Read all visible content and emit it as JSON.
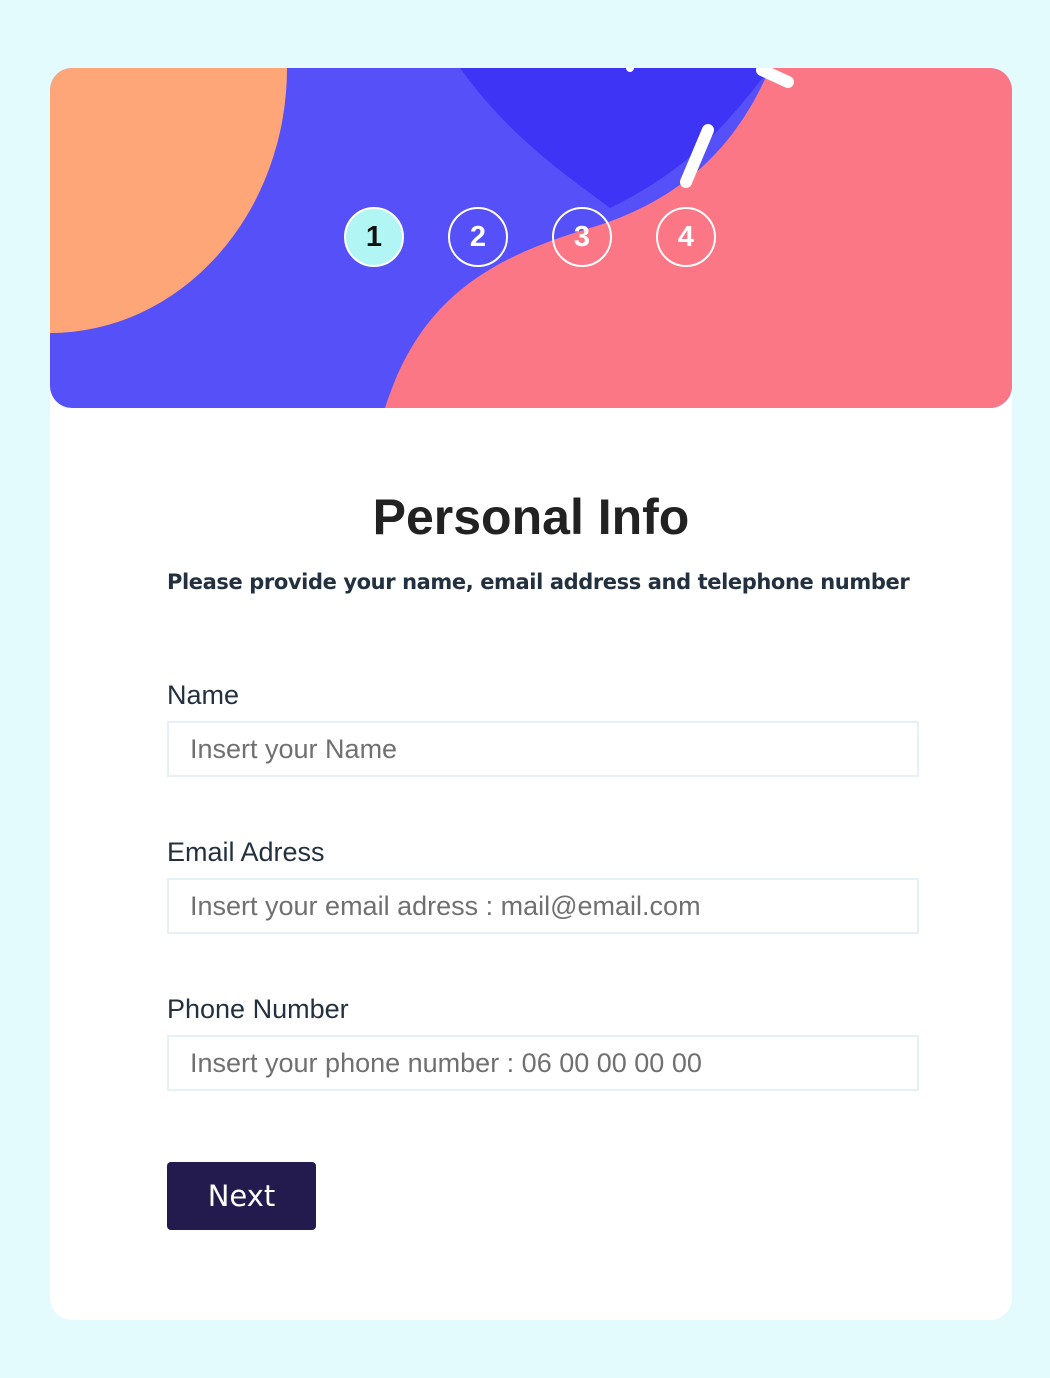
{
  "steps": [
    {
      "number": "1",
      "active": true
    },
    {
      "number": "2",
      "active": false
    },
    {
      "number": "3",
      "active": false
    },
    {
      "number": "4",
      "active": false
    }
  ],
  "form": {
    "title": "Personal Info",
    "subtitle": "Please provide your name, email address and telephone number",
    "fields": [
      {
        "label": "Name",
        "placeholder": "Insert your Name",
        "value": ""
      },
      {
        "label": "Email Adress",
        "placeholder": "Insert your email adress : mail@email.com",
        "value": ""
      },
      {
        "label": "Phone Number",
        "placeholder": "Insert your phone number : 06 00 00 00 00",
        "value": ""
      }
    ],
    "next_label": "Next"
  },
  "colors": {
    "page_background": "#e3fbfd",
    "banner_blue": "#5650f8",
    "banner_dark_blue": "#3e34f6",
    "banner_coral": "#fb7785",
    "banner_orange": "#ffa678",
    "active_step": "#b1f6f4",
    "button": "#231b4d"
  }
}
